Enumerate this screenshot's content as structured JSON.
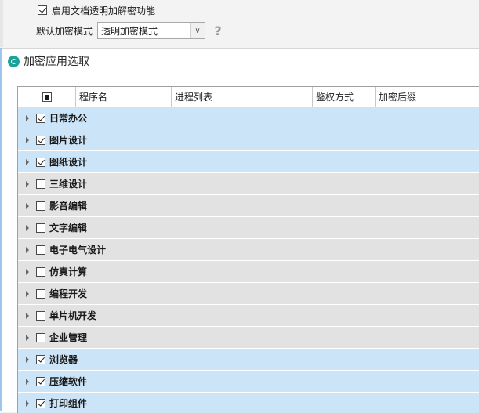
{
  "settings": {
    "enable_label": "启用文档透明加解密功能",
    "enable_checked": true,
    "mode_label": "默认加密模式",
    "mode_value": "透明加密模式",
    "help_glyph": "?"
  },
  "panel": {
    "title": "加密应用选取",
    "icon": "app-logo-icon"
  },
  "grid": {
    "columns": [
      "程序名",
      "进程列表",
      "鉴权方式",
      "加密后缀"
    ],
    "rows": [
      {
        "name": "日常办公",
        "checked": true
      },
      {
        "name": "图片设计",
        "checked": true
      },
      {
        "name": "图纸设计",
        "checked": true
      },
      {
        "name": "三维设计",
        "checked": false
      },
      {
        "name": "影音编辑",
        "checked": false
      },
      {
        "name": "文字编辑",
        "checked": false
      },
      {
        "name": "电子电气设计",
        "checked": false
      },
      {
        "name": "仿真计算",
        "checked": false
      },
      {
        "name": "编程开发",
        "checked": false
      },
      {
        "name": "单片机开发",
        "checked": false
      },
      {
        "name": "企业管理",
        "checked": false
      },
      {
        "name": "浏览器",
        "checked": true
      },
      {
        "name": "压缩软件",
        "checked": true
      },
      {
        "name": "打印组件",
        "checked": true
      }
    ]
  },
  "colors": {
    "selected_row": "#cce4f7",
    "unselected_row": "#e2e2e2",
    "accent": "#0c7bd6",
    "icon": "#1aa39a"
  }
}
